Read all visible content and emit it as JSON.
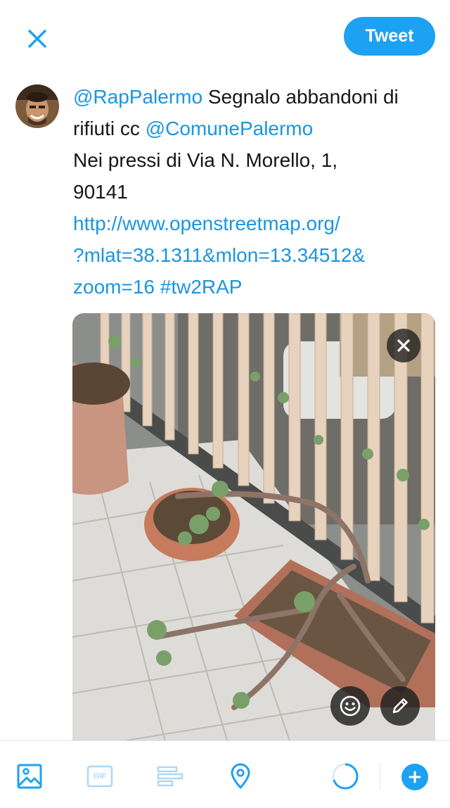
{
  "header": {
    "close_icon": "close-icon",
    "tweet_label": "Tweet"
  },
  "composer": {
    "line1": {
      "mention": "@RapPalermo",
      "text": " Segnalo abbandoni di"
    },
    "line2": {
      "text": "rifiuti cc ",
      "mention": "@ComunePalermo"
    },
    "line3": "Nei pressi di Via N. Morello, 1,",
    "line4": "90141",
    "link_line1": "http://www.openstreetmap.org/",
    "link_line2": "?mlat=38.1311&mlon=13.34512&",
    "link_line3_url": "zoom=16",
    "link_line3_hashtag": " #tw2RAP"
  },
  "attachment": {
    "remove_icon": "close-icon",
    "sticker_icon": "smiley-icon",
    "edit_icon": "pencil-icon"
  },
  "toolbar": {
    "icons": [
      "image-icon",
      "gif-icon",
      "poll-icon",
      "location-icon"
    ],
    "gif_label": "GIF",
    "progress_icon": "character-count-ring",
    "add_icon": "plus-icon"
  },
  "colors": {
    "accent": "#1da1f2",
    "link": "#1b95e0",
    "text": "#14171a"
  }
}
